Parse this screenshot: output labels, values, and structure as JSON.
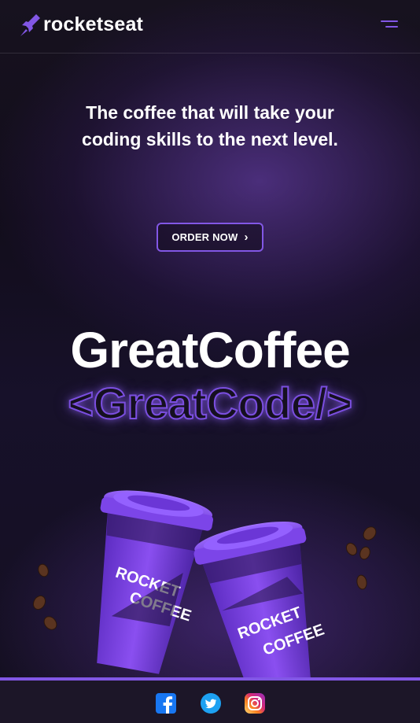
{
  "header": {
    "brand": "rocketseat",
    "menu_icon": "menu-icon"
  },
  "hero": {
    "headline": "The coffee that will take your coding skills to the next level.",
    "order_button": "ORDER NOW",
    "order_chevron": "›",
    "great_coffee": "GreatCoffee",
    "great_code_open": "<",
    "great_code": "GreatCode/",
    "great_code_close": ">"
  },
  "cups": {
    "brand_line1": "ROCKET",
    "brand_line2": "COFFEE"
  },
  "colors": {
    "accent": "#8257e5",
    "background": "#120d1b",
    "cup_purple": "#7a3fe0"
  },
  "footer": {
    "social": [
      "facebook-icon",
      "twitter-icon",
      "instagram-icon"
    ]
  }
}
